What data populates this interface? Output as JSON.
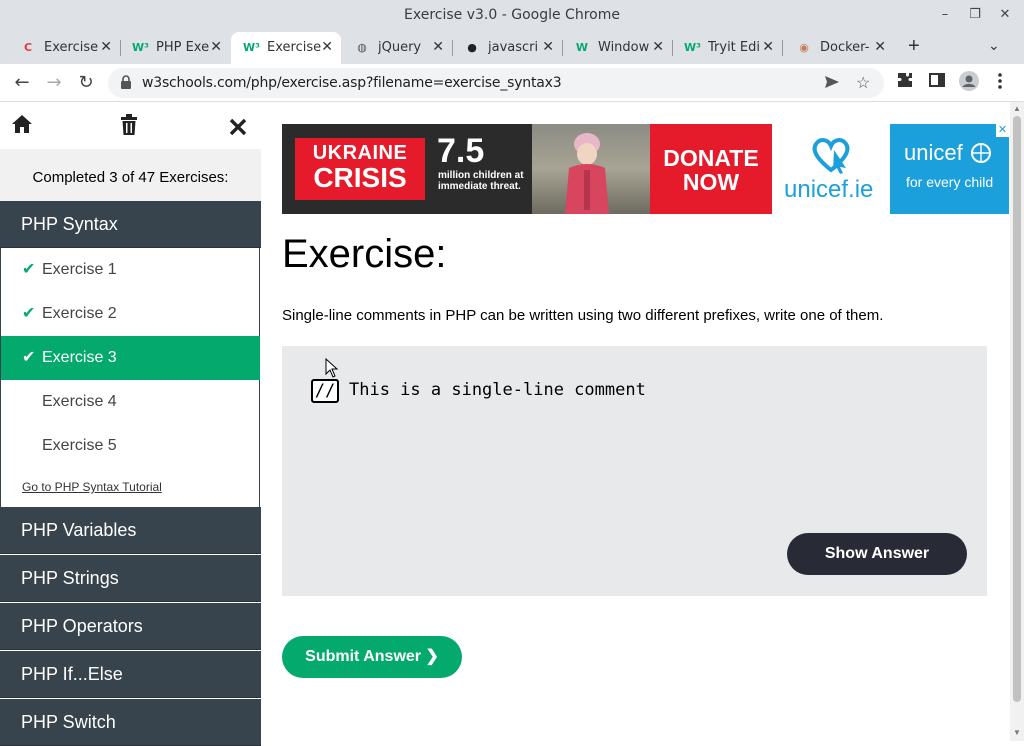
{
  "window": {
    "title": "Exercise v3.0 - Google Chrome",
    "minimize": "–",
    "restore": "❐",
    "close": "✕"
  },
  "tabs": [
    {
      "label": "Exercise",
      "favicon": "C",
      "favicon_color": "#e53935"
    },
    {
      "label": "PHP Exe",
      "favicon": "W³",
      "favicon_color": "#04aa6d"
    },
    {
      "label": "Exercise",
      "favicon": "W³",
      "favicon_color": "#04aa6d",
      "active": true
    },
    {
      "label": "jQuery",
      "favicon": "◍",
      "favicon_color": "#555"
    },
    {
      "label": "javascri",
      "favicon": "●",
      "favicon_color": "#222"
    },
    {
      "label": "Window",
      "favicon": "W",
      "favicon_color": "#04aa6d"
    },
    {
      "label": "Tryit Edi",
      "favicon": "W³",
      "favicon_color": "#04aa6d"
    },
    {
      "label": "Docker-",
      "favicon": "◉",
      "favicon_color": "#c27c5a"
    }
  ],
  "toolbar": {
    "back": "←",
    "forward": "→",
    "reload": "↻",
    "lock": "🔒",
    "url": "w3schools.com/php/exercise.asp?filename=exercise_syntax3",
    "new_tab": "+",
    "tab_search": "⌄"
  },
  "sidebar": {
    "home_icon": "⌂",
    "trash_icon": "🗑",
    "close_icon": "✖",
    "progress": "Completed 3 of 47 Exercises:",
    "category_open": "PHP Syntax",
    "items": [
      {
        "label": "Exercise 1",
        "done": true
      },
      {
        "label": "Exercise 2",
        "done": true
      },
      {
        "label": "Exercise 3",
        "done": true,
        "active": true
      },
      {
        "label": "Exercise 4",
        "done": false
      },
      {
        "label": "Exercise 5",
        "done": false
      }
    ],
    "tutorial_link": "Go to PHP Syntax Tutorial",
    "categories": [
      "PHP Variables",
      "PHP Strings",
      "PHP Operators",
      "PHP If...Else",
      "PHP Switch"
    ]
  },
  "ad": {
    "ukraine_1": "UKRAINE",
    "ukraine_2": "CRISIS",
    "number": "7.5",
    "text": "million children at immediate threat.",
    "donate": "DONATE NOW",
    "unicef_ie": "unicef.ie",
    "unicef": "unicef",
    "tagline": "for every child",
    "close": "✕"
  },
  "exercise": {
    "title": "Exercise:",
    "description": "Single-line comments in PHP can be written using two different prefixes, write one of them.",
    "input_value": "//",
    "code": "This is a single-line comment",
    "show_answer": "Show Answer",
    "submit": "Submit Answer ❯"
  },
  "colors": {
    "accent_green": "#04aa6d",
    "sidebar_dark": "#38444d",
    "button_dark": "#282a35"
  }
}
